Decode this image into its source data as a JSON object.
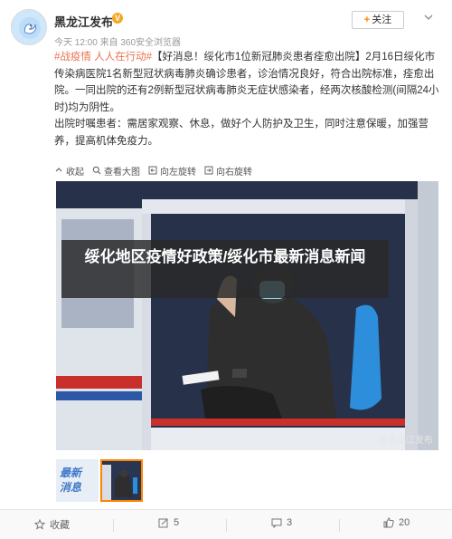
{
  "post": {
    "author": "黑龙江发布",
    "verified_badge": "V",
    "meta": "今天 12:00 来自 360安全浏览器",
    "follow_label": "关注",
    "follow_plus": "+",
    "tag": "#战疫情 人人在行动#",
    "paragraph1_rest": "【好消息！绥化市1位新冠肺炎患者痊愈出院】2月16日绥化市传染病医院1名新型冠状病毒肺炎确诊患者，诊治情况良好，符合出院标准，痊愈出院。一同出院的还有2例新型冠状病毒肺炎无症状感染者，经两次核酸检测(间隔24小时)均为阴性。",
    "paragraph2": "出院时嘱患者：需居家观察、休息，做好个人防护及卫生，同时注意保暖，加强营养，提高机体免疫力。"
  },
  "actions": [
    {
      "icon": "collect-icon",
      "label": "收起"
    },
    {
      "icon": "view-large-icon",
      "label": "查看大图"
    },
    {
      "icon": "rotate-left-icon",
      "label": "向左旋转"
    },
    {
      "icon": "rotate-right-icon",
      "label": "向右旋转"
    }
  ],
  "photo": {
    "watermark": "@黑龙江发布",
    "banner": "绥化地区疫情好政策/绥化市最新消息新闻"
  },
  "thumbnail": {
    "text_line1": "最新",
    "text_line2": "消息"
  },
  "footer": {
    "favorite": "收藏",
    "repost_count": "5",
    "comment_count": "3",
    "like_count": "20"
  },
  "colors": {
    "accent_orange": "#ff8200",
    "tag_color": "#eb7350",
    "footer_bg": "#f9f9f9"
  }
}
